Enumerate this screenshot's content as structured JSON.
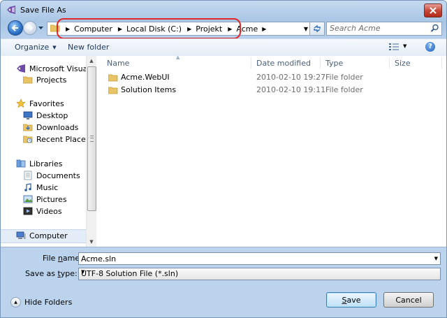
{
  "window": {
    "title": "Save File As",
    "close_icon": "close-icon"
  },
  "address": {
    "crumbs": [
      "Computer",
      "Local Disk (C:)",
      "Projekt",
      "Acme"
    ]
  },
  "search": {
    "placeholder": "Search Acme"
  },
  "toolbar": {
    "organize_label": "Organize",
    "new_folder_label": "New folder"
  },
  "nav": {
    "items": [
      {
        "label": "Microsoft Visual St",
        "icon": "visual-studio-icon",
        "kind": "head"
      },
      {
        "label": "Projects",
        "icon": "folder-icon",
        "kind": "child"
      },
      {
        "label": "Favorites",
        "icon": "star-icon",
        "kind": "head"
      },
      {
        "label": "Desktop",
        "icon": "desktop-icon",
        "kind": "child"
      },
      {
        "label": "Downloads",
        "icon": "downloads-icon",
        "kind": "child"
      },
      {
        "label": "Recent Places",
        "icon": "recent-places-icon",
        "kind": "child"
      },
      {
        "label": "Libraries",
        "icon": "libraries-icon",
        "kind": "head"
      },
      {
        "label": "Documents",
        "icon": "documents-icon",
        "kind": "child"
      },
      {
        "label": "Music",
        "icon": "music-icon",
        "kind": "child"
      },
      {
        "label": "Pictures",
        "icon": "pictures-icon",
        "kind": "child"
      },
      {
        "label": "Videos",
        "icon": "videos-icon",
        "kind": "child"
      },
      {
        "label": "Computer",
        "icon": "computer-icon",
        "kind": "head"
      }
    ]
  },
  "columns": {
    "name": "Name",
    "date": "Date modified",
    "type": "Type",
    "size": "Size"
  },
  "files": [
    {
      "name": "Acme.WebUI",
      "date": "2010-02-10 19:27",
      "type": "File folder",
      "size": ""
    },
    {
      "name": "Solution Items",
      "date": "2010-02-10 19:11",
      "type": "File folder",
      "size": ""
    }
  ],
  "form": {
    "file_name_label_pre": "File ",
    "file_name_label_key": "n",
    "file_name_label_post": "ame:",
    "file_name_value": "Acme.sln",
    "save_type_label_pre": "Save as ",
    "save_type_label_key": "t",
    "save_type_label_post": "ype:",
    "save_type_value": "UTF-8 Solution File (*.sln)"
  },
  "footer": {
    "hide_folders_label": "Hide Folders",
    "save_key": "S",
    "save_rest": "ave",
    "cancel_label": "Cancel"
  }
}
